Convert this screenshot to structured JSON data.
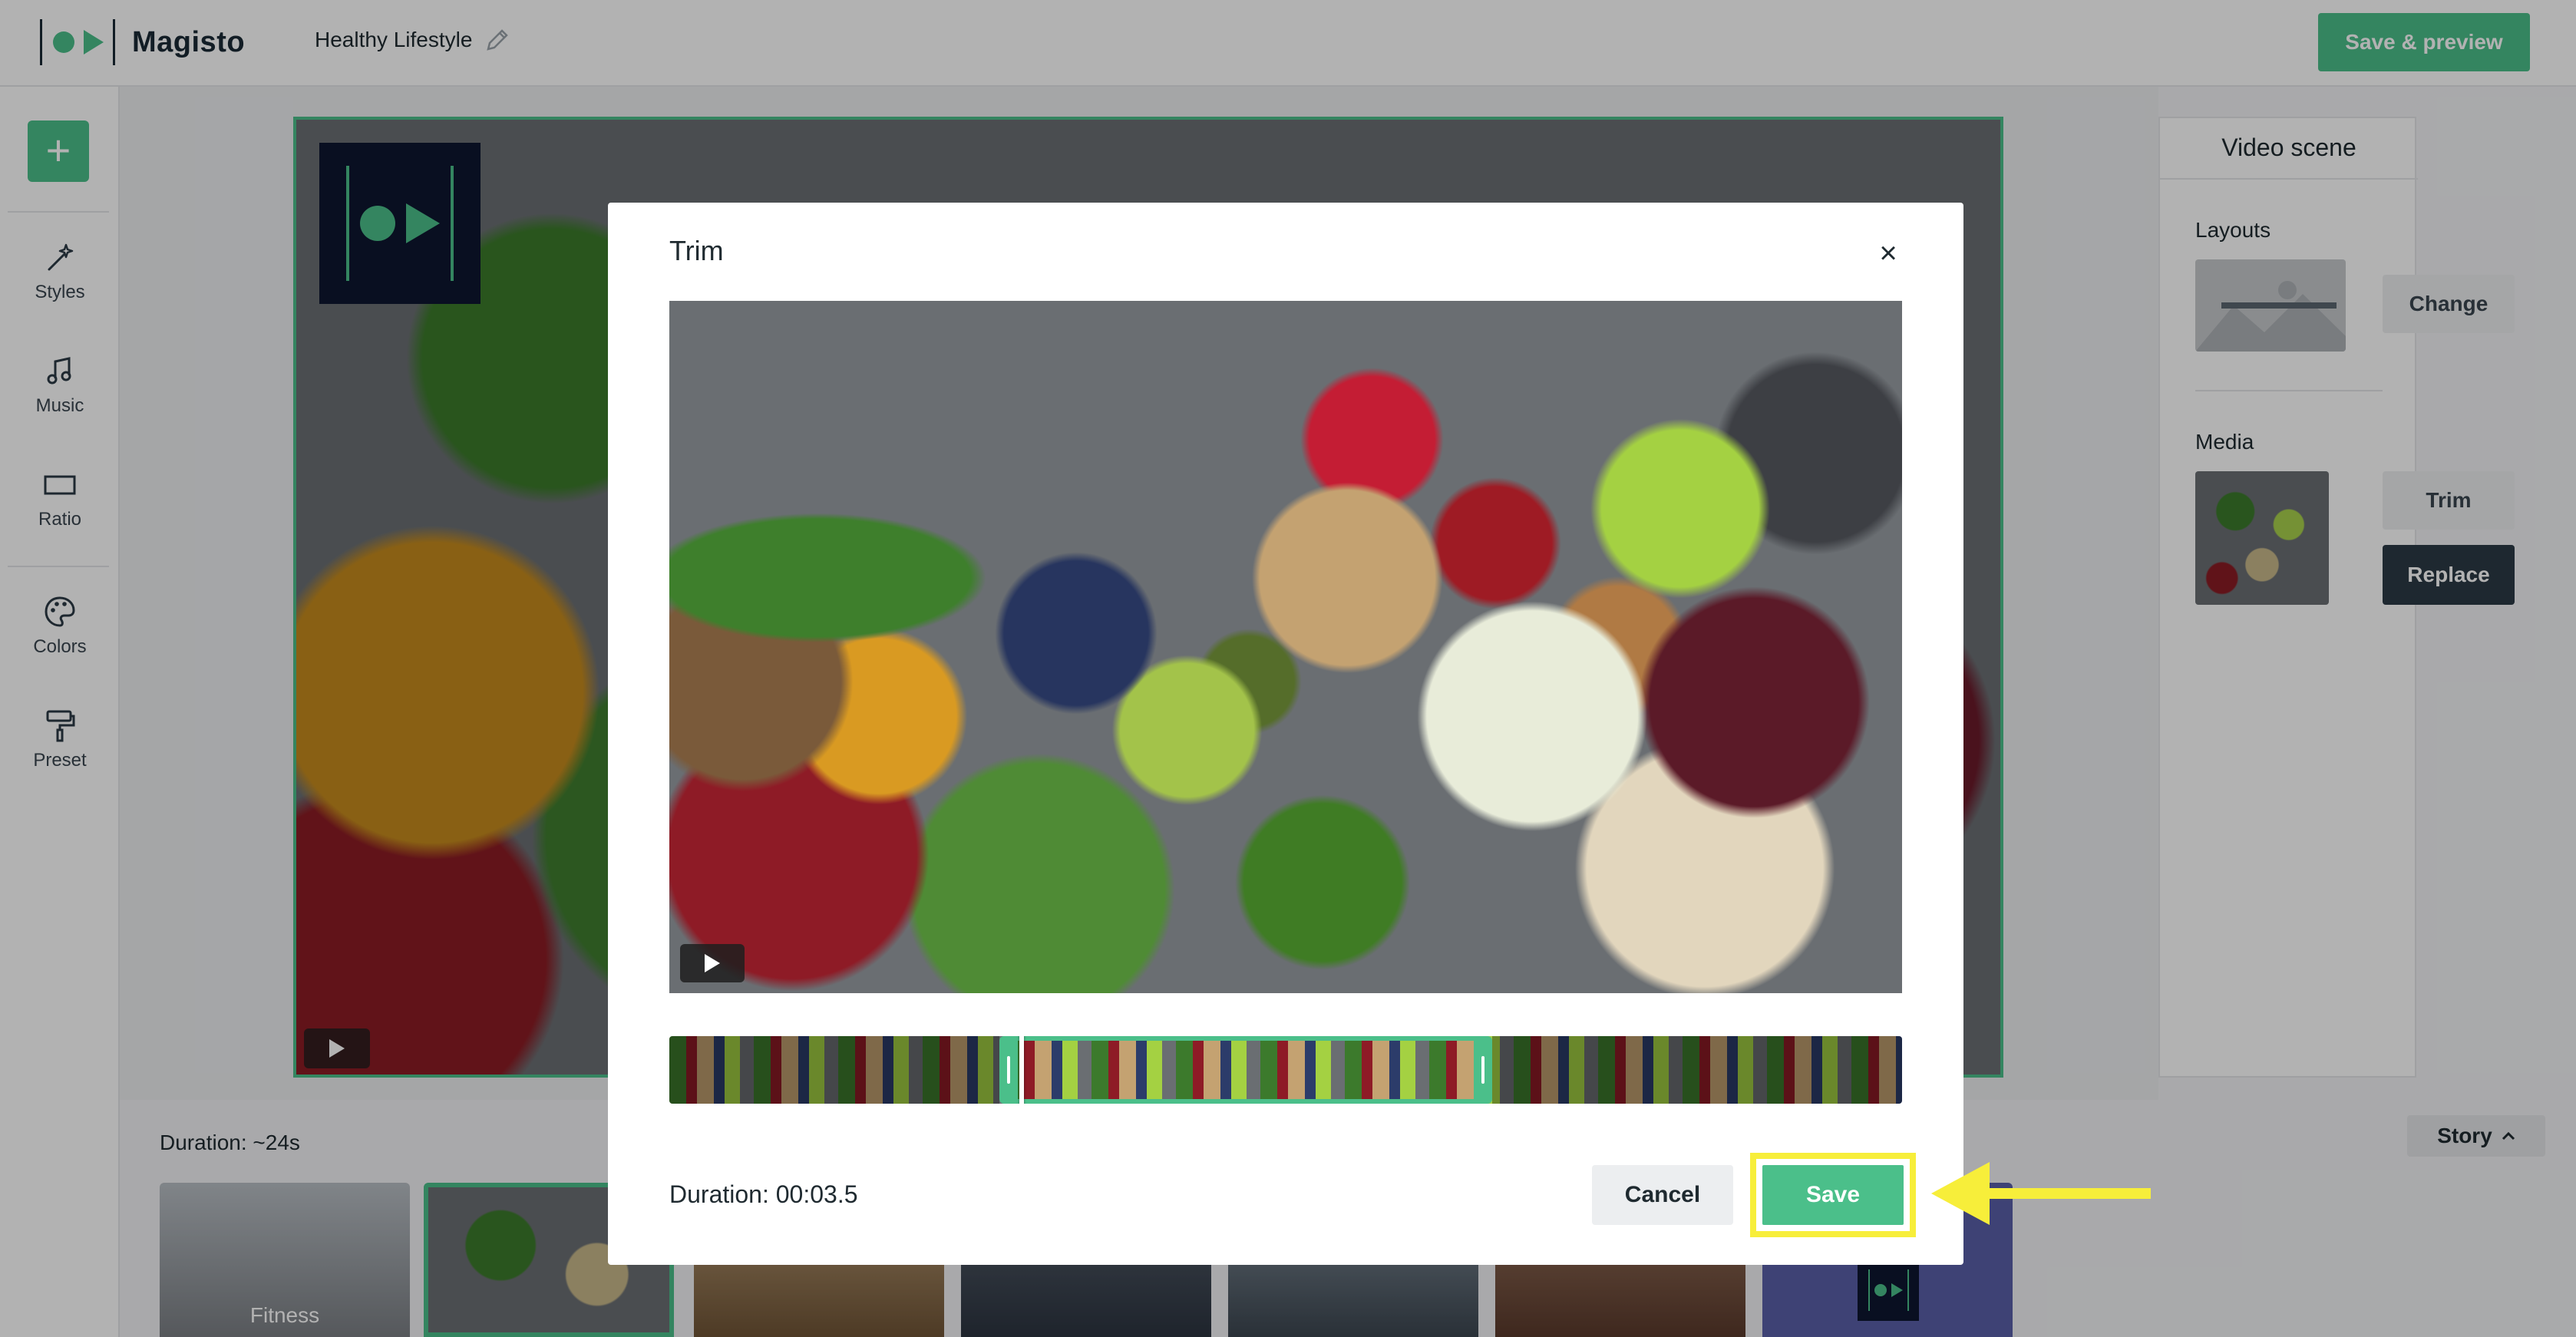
{
  "app": {
    "brand": "Magisto",
    "project_title": "Healthy Lifestyle",
    "save_preview_label": "Save & preview"
  },
  "sidebar": {
    "add_label": "+",
    "items": [
      {
        "label": "Styles",
        "icon": "magic-wand-icon"
      },
      {
        "label": "Music",
        "icon": "music-note-icon"
      },
      {
        "label": "Ratio",
        "icon": "rectangle-icon"
      },
      {
        "label": "Colors",
        "icon": "palette-icon"
      },
      {
        "label": "Preset",
        "icon": "paint-roller-icon"
      }
    ]
  },
  "panel": {
    "title": "Video scene",
    "layouts_label": "Layouts",
    "change_label": "Change",
    "media_label": "Media",
    "trim_label": "Trim",
    "replace_label": "Replace"
  },
  "bottom": {
    "duration": "Duration: ~24s",
    "story_label": "Story",
    "thumbs": [
      {
        "label": "Fitness"
      },
      {
        "label": ""
      },
      {
        "label": ""
      },
      {
        "label": ""
      },
      {
        "label": ""
      },
      {
        "label": ""
      },
      {
        "label": ""
      }
    ]
  },
  "modal": {
    "title": "Trim",
    "close_label": "×",
    "duration": "Duration: 00:03.5",
    "cancel_label": "Cancel",
    "save_label": "Save"
  },
  "colors": {
    "accent": "#4bbf8a",
    "dark": "#2b3a45",
    "highlight": "#f7ee3a"
  }
}
